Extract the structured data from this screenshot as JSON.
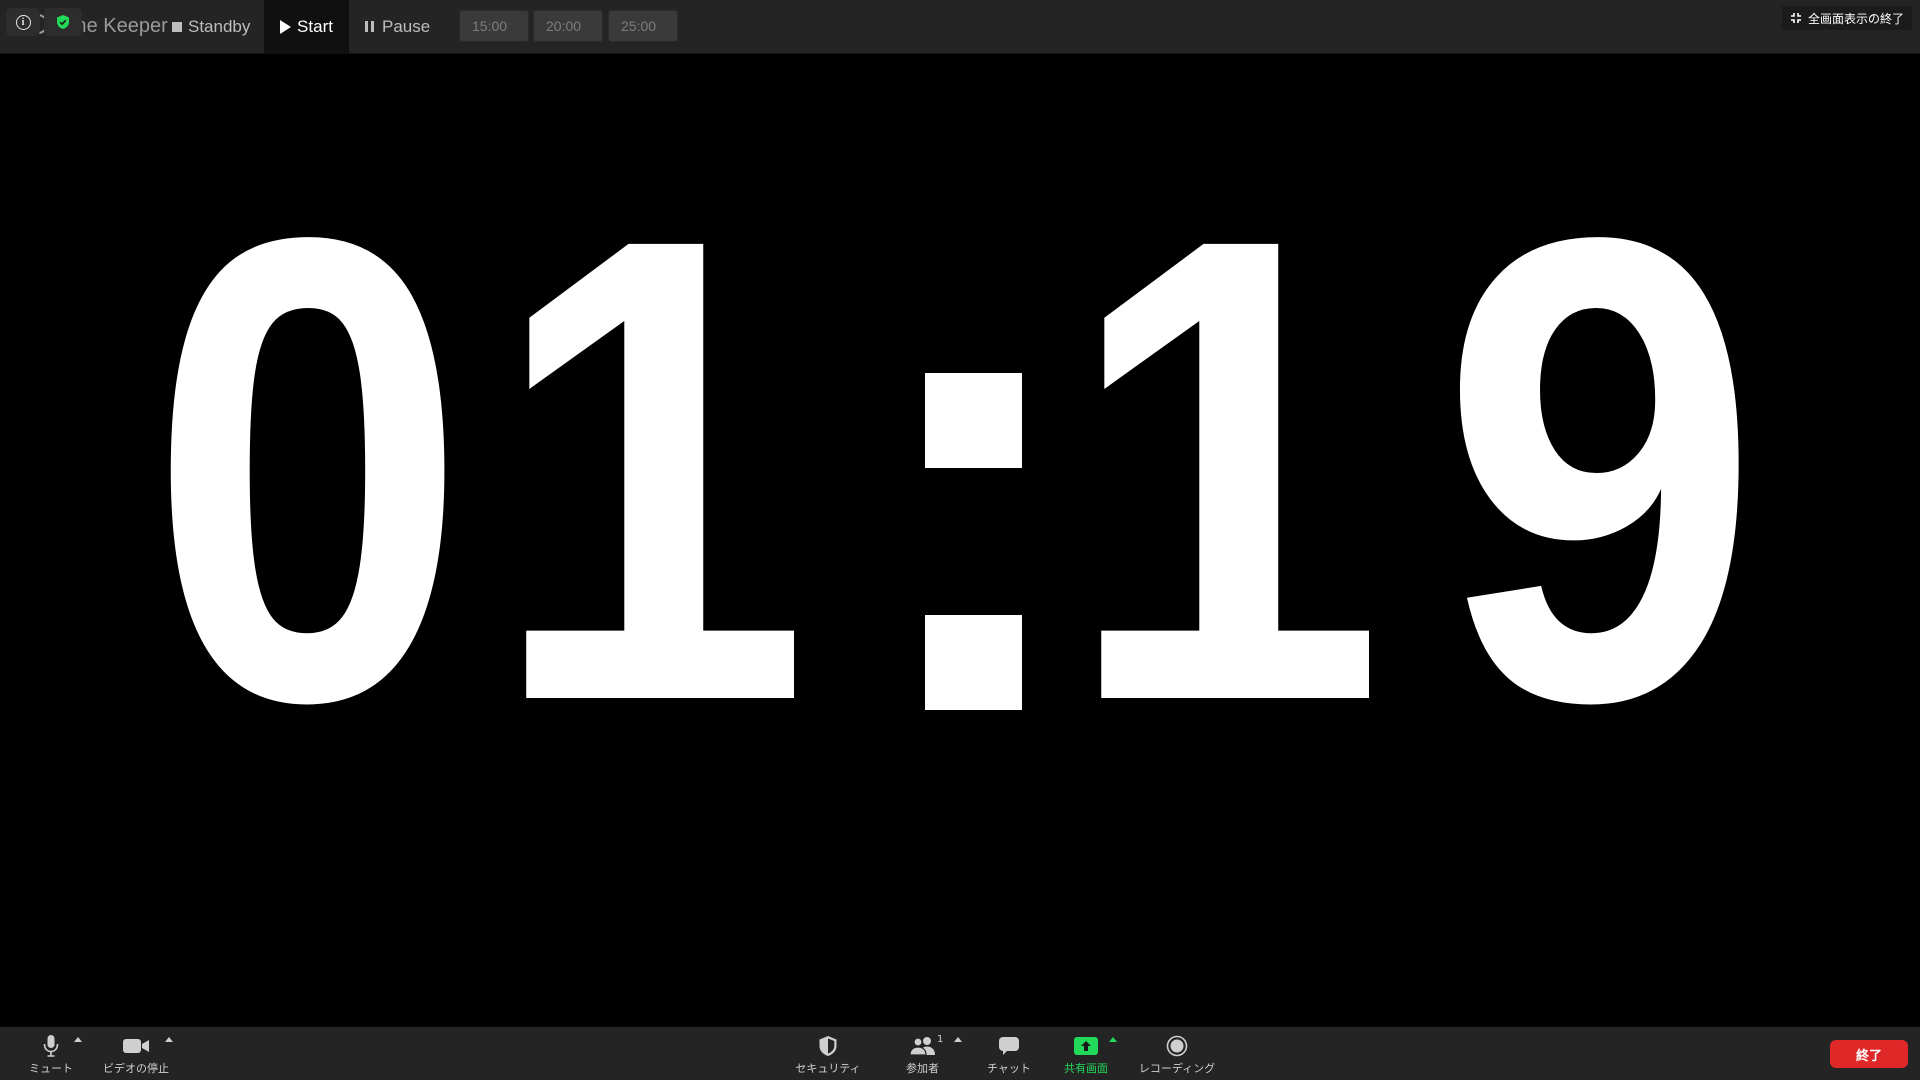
{
  "topbar": {
    "app_title": "Time Keeper",
    "standby_label": "Standby",
    "start_label": "Start",
    "pause_label": "Pause",
    "presets": [
      "15:00",
      "20:00",
      "25:00"
    ],
    "exit_fullscreen_label": "全画面表示の終了"
  },
  "timer": {
    "display": "01:19",
    "digits": [
      "0",
      "1",
      ":",
      "1",
      "9"
    ]
  },
  "toolbar": {
    "mute_label": "ミュート",
    "video_label": "ビデオの停止",
    "security_label": "セキュリティ",
    "participants_label": "参加者",
    "participants_count": "1",
    "chat_label": "チャット",
    "share_label": "共有画面",
    "record_label": "レコーディング",
    "end_label": "終了"
  },
  "colors": {
    "background": "#000000",
    "bar": "#242424",
    "accent_green": "#23d959",
    "end_red": "#e02828"
  },
  "icons": [
    "info-icon",
    "shield-icon",
    "stop-icon",
    "play-icon",
    "pause-icon",
    "exit-fullscreen-icon",
    "microphone-icon",
    "video-camera-icon",
    "security-shield-icon",
    "participants-icon",
    "chat-icon",
    "share-screen-icon",
    "record-icon"
  ]
}
